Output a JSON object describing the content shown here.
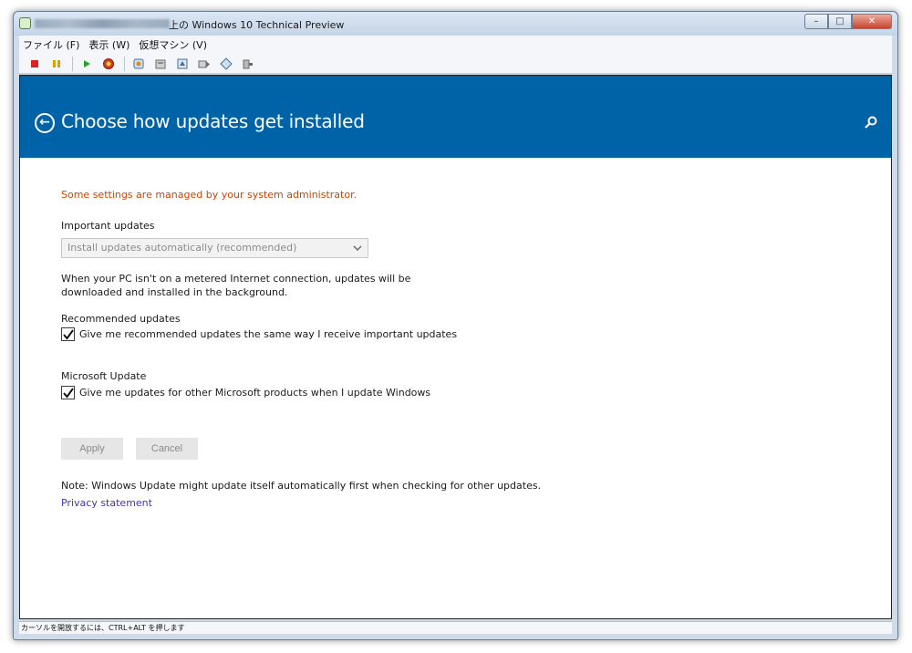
{
  "vm_window": {
    "title_suffix": "上の Windows 10 Technical Preview",
    "controls": {
      "minimize_icon": "minimize-icon",
      "maximize_icon": "maximize-icon",
      "close_icon": "close-icon"
    },
    "menu": [
      "ファイル (F)",
      "表示 (W)",
      "仮想マシン (V)"
    ],
    "toolbar_icons": [
      "stop-icon",
      "pause-icon",
      "play-icon",
      "reset-icon",
      "snapshot-icon",
      "revert-icon",
      "settings-icon",
      "send-keys-icon",
      "usb-icon",
      "tools-icon"
    ],
    "status_text": "カーソルを開放するには、CTRL+ALT を押します"
  },
  "header": {
    "back_icon": "back-arrow-icon",
    "title": "Choose how updates get installed",
    "search_icon": "search-icon",
    "background": "#0063a7"
  },
  "settings": {
    "admin_note": "Some settings are managed by your system administrator.",
    "important_updates": {
      "label": "Important updates",
      "selected_value": "Install updates automatically (recommended)"
    },
    "description": "When your PC isn't on a metered Internet connection, updates will be downloaded and installed in the background.",
    "recommended_updates": {
      "label": "Recommended updates",
      "checkbox_label": "Give me recommended updates the same way I receive important updates",
      "checked": true
    },
    "microsoft_update": {
      "label": "Microsoft Update",
      "checkbox_label": "Give me updates for other Microsoft products when I update Windows",
      "checked": true
    },
    "apply_label": "Apply",
    "cancel_label": "Cancel",
    "note": "Note: Windows Update might update itself automatically first when checking for other updates.",
    "privacy_link": "Privacy statement"
  },
  "colors": {
    "accent": "#0063a7",
    "warning_text": "#d14300",
    "link": "#4a32a8"
  }
}
